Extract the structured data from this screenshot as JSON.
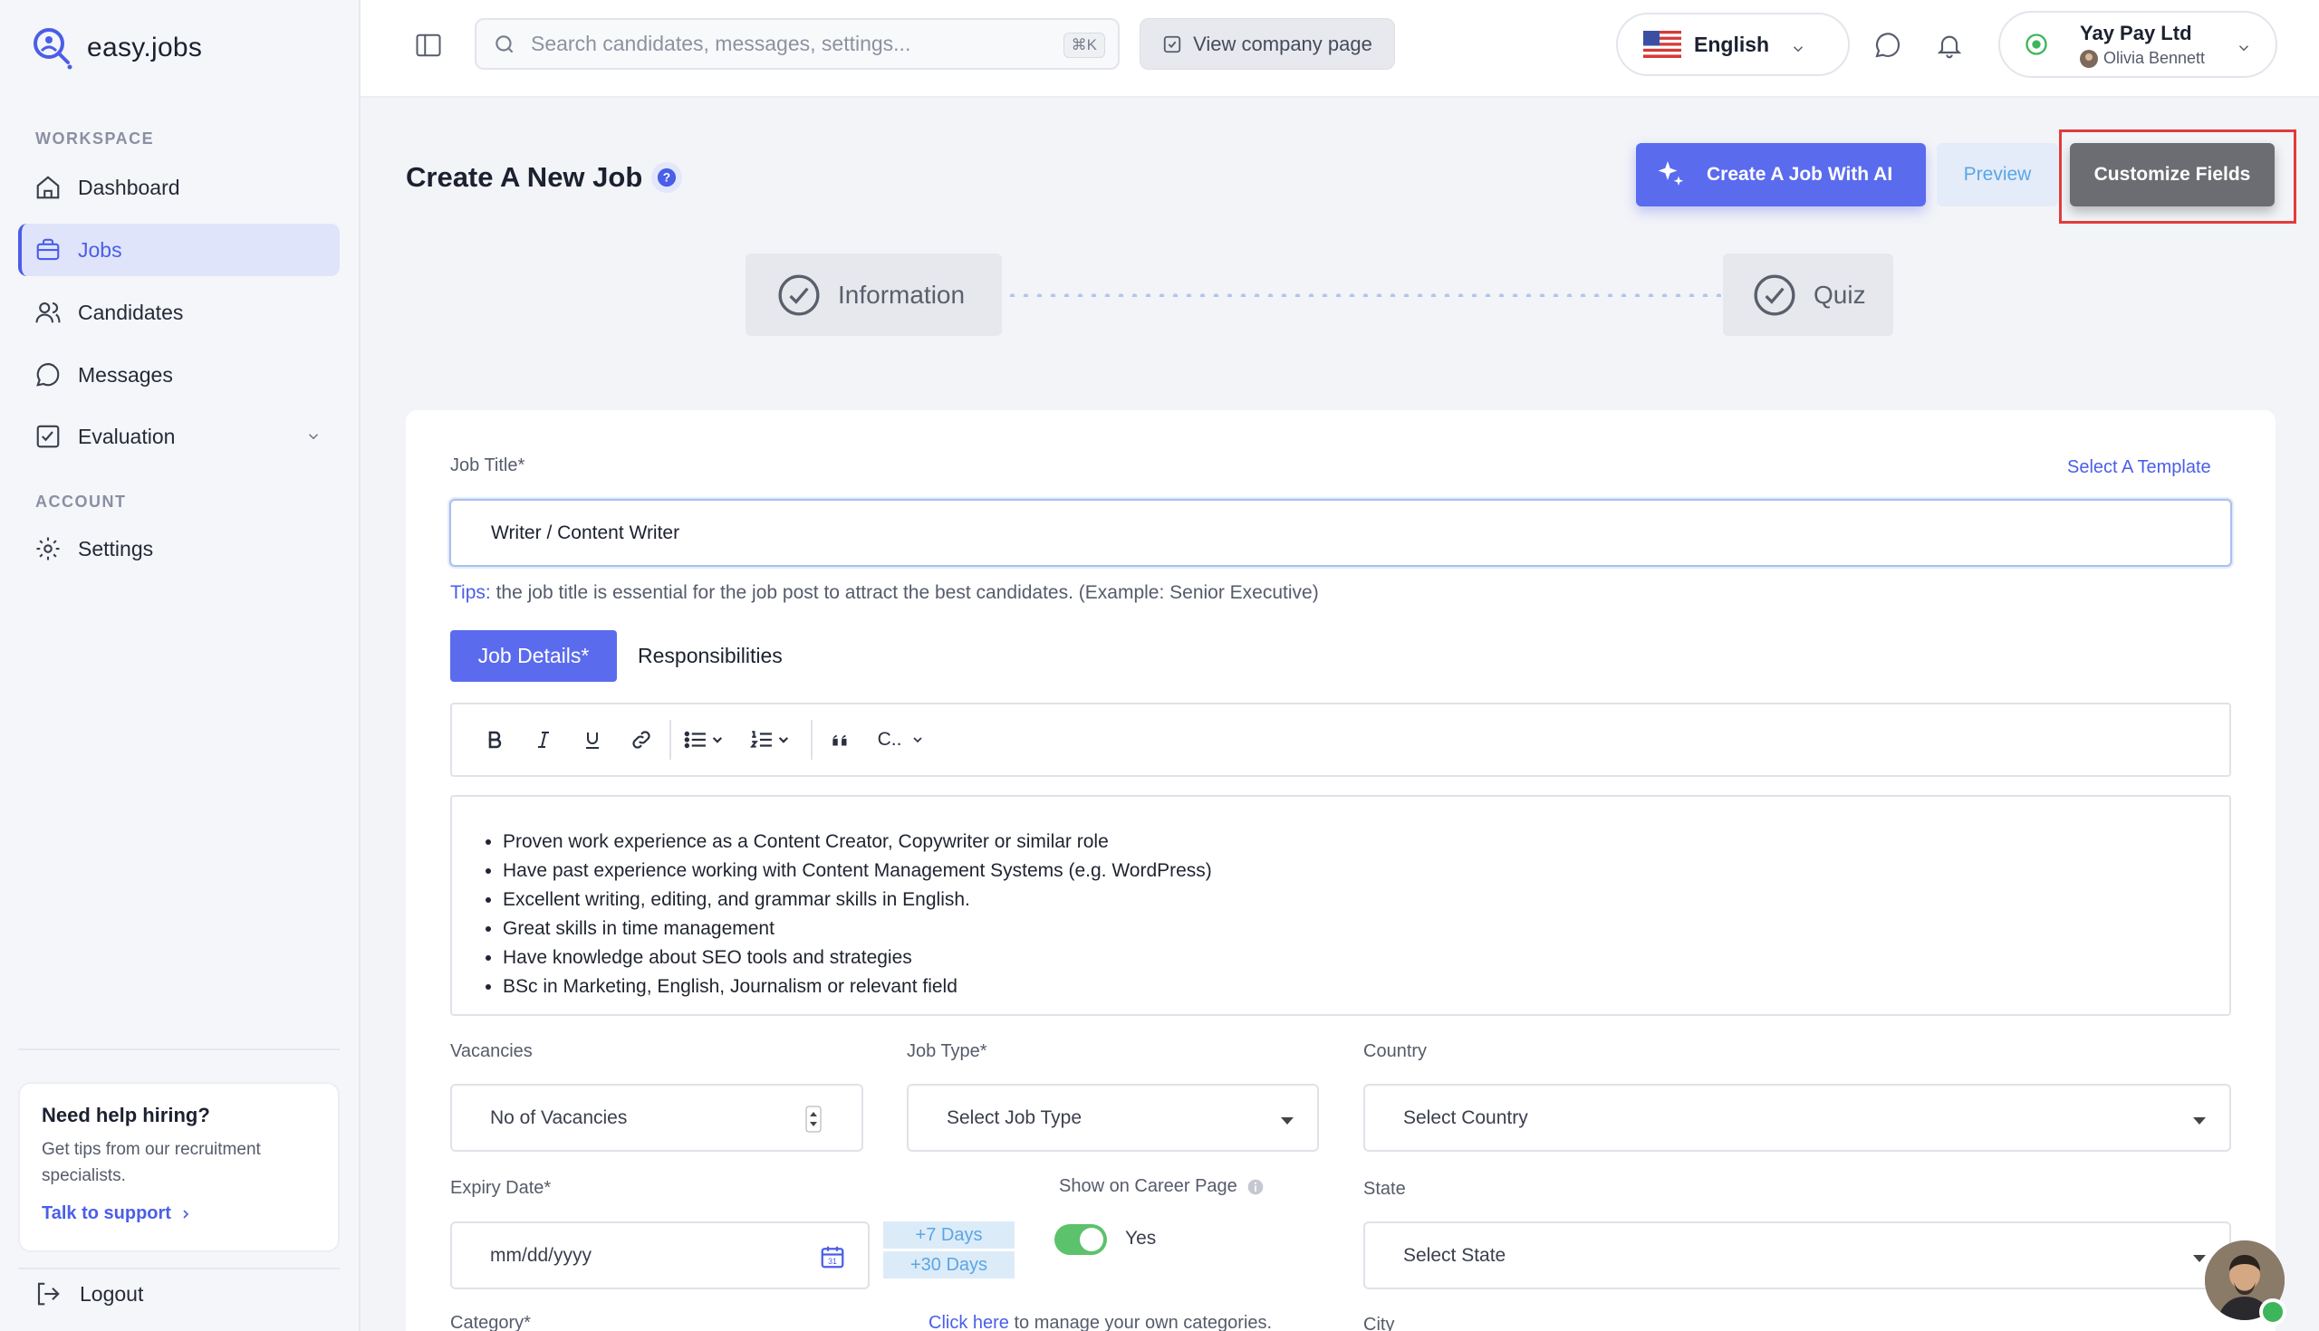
{
  "app": {
    "logo_text": "easy.jobs"
  },
  "sidebar": {
    "workspace_label": "WORKSPACE",
    "account_label": "ACCOUNT",
    "items": [
      {
        "label": "Dashboard",
        "icon": "home-icon"
      },
      {
        "label": "Jobs",
        "icon": "briefcase-icon",
        "active": true
      },
      {
        "label": "Candidates",
        "icon": "users-icon"
      },
      {
        "label": "Messages",
        "icon": "chat-icon"
      },
      {
        "label": "Evaluation",
        "icon": "checklist-icon"
      }
    ],
    "settings_label": "Settings",
    "help": {
      "title": "Need help hiring?",
      "text": "Get tips from our recruitment specialists.",
      "link": "Talk to support"
    },
    "logout_label": "Logout"
  },
  "topbar": {
    "search_placeholder": "Search candidates, messages, settings...",
    "search_shortcut": "⌘K",
    "view_company": "View company page",
    "language": "English",
    "company_name": "Yay Pay Ltd",
    "user_name": "Olivia Bennett"
  },
  "page": {
    "title": "Create A New Job",
    "btn_ai": "Create A Job With AI",
    "btn_preview": "Preview",
    "btn_customize": "Customize Fields",
    "steps": [
      "Information",
      "Quiz"
    ]
  },
  "form": {
    "job_title_label": "Job Title*",
    "select_template": "Select A Template",
    "job_title_value": "Writer / Content Writer",
    "tips_prefix": "Tips:",
    "tips_text": " the job title is essential for the job post to attract the best candidates. (Example: Senior Executive)",
    "tab_details": "Job Details*",
    "tab_responsibilities": "Responsibilities",
    "toolbar_style": "C..",
    "editor_items": [
      "Proven work experience as a Content Creator, Copywriter or similar role",
      "Have past experience working with Content Management Systems (e.g. WordPress)",
      "Excellent writing, editing, and grammar skills in English.",
      "Great skills in time management",
      "Have knowledge about SEO tools and strategies",
      "BSc in Marketing, English, Journalism or relevant field"
    ],
    "vacancies_label": "Vacancies",
    "vacancies_placeholder": "No of Vacancies",
    "job_type_label": "Job Type*",
    "job_type_placeholder": "Select Job Type",
    "country_label": "Country",
    "country_placeholder": "Select Country",
    "expiry_label": "Expiry Date*",
    "expiry_placeholder": "mm/dd/yyyy",
    "plus7": "+7 Days",
    "plus30": "+30 Days",
    "career_label": "Show on Career Page",
    "career_value": "Yes",
    "state_label": "State",
    "state_placeholder": "Select State",
    "category_label": "Category*",
    "category_link": "Click here",
    "category_link_suffix": " to manage your own categories.",
    "city_label": "City"
  },
  "colors": {
    "accent": "#5a6bee",
    "highlight": "#e03c3c",
    "toggle_on": "#5cc26b"
  }
}
